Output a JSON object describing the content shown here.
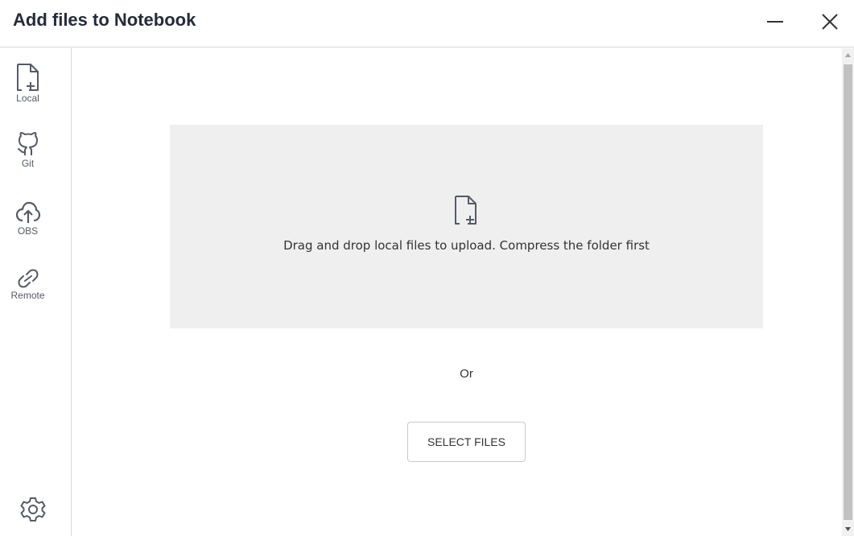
{
  "dialog": {
    "title": "Add files to Notebook"
  },
  "window_controls": {
    "minimize_icon": "minimize-icon",
    "close_icon": "close-icon"
  },
  "sidebar": {
    "items": [
      {
        "label": "Local",
        "icon": "file-add-icon"
      },
      {
        "label": "Git",
        "icon": "github-icon"
      },
      {
        "label": "OBS",
        "icon": "cloud-upload-icon"
      },
      {
        "label": "Remote",
        "icon": "link-icon"
      }
    ],
    "settings_icon": "gear-icon"
  },
  "upload": {
    "dropzone_text": "Drag and drop local files to upload. Compress the folder first",
    "dropzone_icon": "file-add-icon",
    "or_text": "Or",
    "select_button_label": "SELECT FILES"
  },
  "colors": {
    "dropzone_bg": "#efefef",
    "border": "#d9d9d9",
    "icon": "#555a66"
  }
}
